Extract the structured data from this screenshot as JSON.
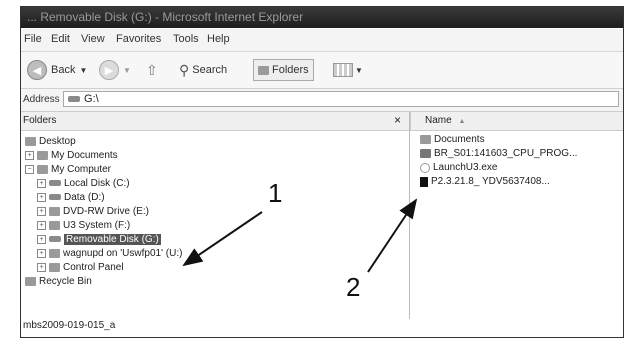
{
  "window": {
    "title": "... Removable Disk (G:) - Microsoft Internet Explorer"
  },
  "menu": [
    "File",
    "Edit",
    "View",
    "Favorites",
    "Tools",
    "Help"
  ],
  "toolbar": {
    "back_label": "Back",
    "search_label": "Search",
    "folders_label": "Folders"
  },
  "address": {
    "label": "Address",
    "value": "G:\\"
  },
  "left_pane": {
    "header": "Folders",
    "close": "×",
    "tree": [
      {
        "label": "Desktop"
      },
      {
        "label": "My Documents"
      },
      {
        "label": "My Computer"
      },
      {
        "label": "Local Disk (C:)"
      },
      {
        "label": "Data (D:)"
      },
      {
        "label": "DVD-RW Drive (E:)"
      },
      {
        "label": "U3 System (F:)"
      },
      {
        "label": "Removable Disk (G:)"
      },
      {
        "label": "wagnupd on 'Uswfp01' (U:)"
      },
      {
        "label": "Control Panel"
      },
      {
        "label": "Recycle Bin"
      }
    ]
  },
  "right_pane": {
    "column": "Name",
    "sort": "▲",
    "files": [
      {
        "name": "Documents"
      },
      {
        "name": "BR_S01:141603_CPU_PROG..."
      },
      {
        "name": "LaunchU3.exe"
      },
      {
        "name": "P2.3.21.8_ YDV5637408..."
      }
    ]
  },
  "annotations": {
    "one": "1",
    "two": "2"
  },
  "caption": "mbs2009-019-015_a"
}
